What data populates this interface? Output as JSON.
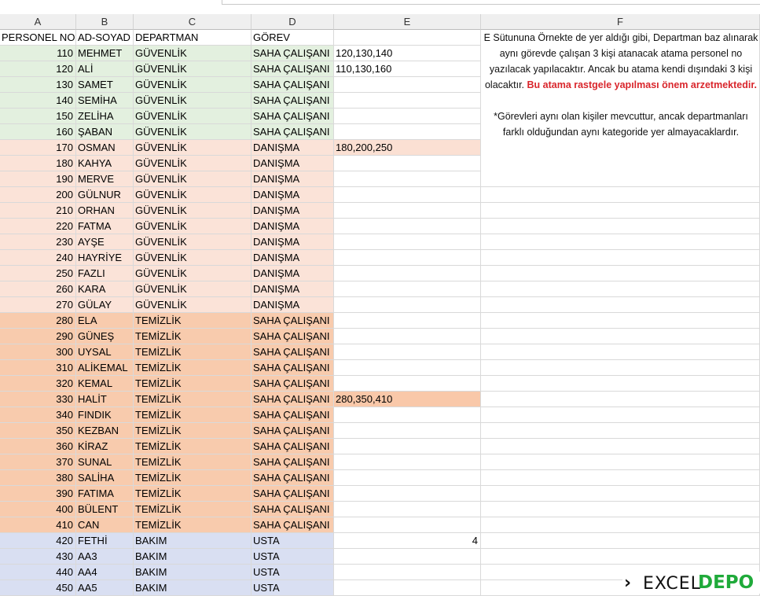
{
  "columns": [
    "A",
    "B",
    "C",
    "D",
    "E",
    "F"
  ],
  "header": [
    "PERSONEL NO",
    "AD-SOYAD",
    "DEPARTMAN",
    "GÖREV",
    "",
    ""
  ],
  "colors": {
    "green": "#e3f0df",
    "peach": "#fbe3d8",
    "orange": "#f8cbad",
    "blue": "#d9dff2",
    "e_highlight_peach": "#fbe0d3",
    "e_highlight_orange": "#f9c8a9",
    "note_red": "#d9262c",
    "logo_green": "#1faa3a"
  },
  "rows": [
    {
      "no": "110",
      "name": "MEHMET",
      "dept": "GÜVENLİK",
      "task": "SAHA ÇALIŞANI",
      "e": "120,130,140",
      "group": "green"
    },
    {
      "no": "120",
      "name": "ALİ",
      "dept": "GÜVENLİK",
      "task": "SAHA ÇALIŞANI",
      "e": "110,130,160",
      "group": "green"
    },
    {
      "no": "130",
      "name": "SAMET",
      "dept": "GÜVENLİK",
      "task": "SAHA ÇALIŞANI",
      "e": "",
      "group": "green"
    },
    {
      "no": "140",
      "name": "SEMİHA",
      "dept": "GÜVENLİK",
      "task": "SAHA ÇALIŞANI",
      "e": "",
      "group": "green"
    },
    {
      "no": "150",
      "name": "ZELİHA",
      "dept": "GÜVENLİK",
      "task": "SAHA ÇALIŞANI",
      "e": "",
      "group": "green"
    },
    {
      "no": "160",
      "name": "ŞABAN",
      "dept": "GÜVENLİK",
      "task": "SAHA ÇALIŞANI",
      "e": "",
      "group": "green"
    },
    {
      "no": "170",
      "name": "OSMAN",
      "dept": "GÜVENLİK",
      "task": "DANIŞMA",
      "e": "180,200,250",
      "group": "peach",
      "ehl": "e_highlight_peach"
    },
    {
      "no": "180",
      "name": "KAHYA",
      "dept": "GÜVENLİK",
      "task": "DANIŞMA",
      "e": "",
      "group": "peach"
    },
    {
      "no": "190",
      "name": "MERVE",
      "dept": "GÜVENLİK",
      "task": "DANIŞMA",
      "e": "",
      "group": "peach"
    },
    {
      "no": "200",
      "name": "GÜLNUR",
      "dept": "GÜVENLİK",
      "task": "DANIŞMA",
      "e": "",
      "group": "peach"
    },
    {
      "no": "210",
      "name": "ORHAN",
      "dept": "GÜVENLİK",
      "task": "DANIŞMA",
      "e": "",
      "group": "peach"
    },
    {
      "no": "220",
      "name": "FATMA",
      "dept": "GÜVENLİK",
      "task": "DANIŞMA",
      "e": "",
      "group": "peach"
    },
    {
      "no": "230",
      "name": "AYŞE",
      "dept": "GÜVENLİK",
      "task": "DANIŞMA",
      "e": "",
      "group": "peach"
    },
    {
      "no": "240",
      "name": "HAYRİYE",
      "dept": "GÜVENLİK",
      "task": "DANIŞMA",
      "e": "",
      "group": "peach"
    },
    {
      "no": "250",
      "name": "FAZLI",
      "dept": "GÜVENLİK",
      "task": "DANIŞMA",
      "e": "",
      "group": "peach"
    },
    {
      "no": "260",
      "name": "KARA",
      "dept": "GÜVENLİK",
      "task": "DANIŞMA",
      "e": "",
      "group": "peach"
    },
    {
      "no": "270",
      "name": "GÜLAY",
      "dept": "GÜVENLİK",
      "task": "DANIŞMA",
      "e": "",
      "group": "peach"
    },
    {
      "no": "280",
      "name": "ELA",
      "dept": "TEMİZLİK",
      "task": "SAHA ÇALIŞANI",
      "e": "",
      "group": "orange"
    },
    {
      "no": "290",
      "name": "GÜNEŞ",
      "dept": "TEMİZLİK",
      "task": "SAHA ÇALIŞANI",
      "e": "",
      "group": "orange"
    },
    {
      "no": "300",
      "name": "UYSAL",
      "dept": "TEMİZLİK",
      "task": "SAHA ÇALIŞANI",
      "e": "",
      "group": "orange"
    },
    {
      "no": "310",
      "name": "ALİKEMAL",
      "dept": "TEMİZLİK",
      "task": "SAHA ÇALIŞANI",
      "e": "",
      "group": "orange"
    },
    {
      "no": "320",
      "name": "KEMAL",
      "dept": "TEMİZLİK",
      "task": "SAHA ÇALIŞANI",
      "e": "",
      "group": "orange"
    },
    {
      "no": "330",
      "name": "HALİT",
      "dept": "TEMİZLİK",
      "task": "SAHA ÇALIŞANI",
      "e": "280,350,410",
      "group": "orange",
      "ehl": "e_highlight_orange"
    },
    {
      "no": "340",
      "name": "FINDIK",
      "dept": "TEMİZLİK",
      "task": "SAHA ÇALIŞANI",
      "e": "",
      "group": "orange"
    },
    {
      "no": "350",
      "name": "KEZBAN",
      "dept": "TEMİZLİK",
      "task": "SAHA ÇALIŞANI",
      "e": "",
      "group": "orange"
    },
    {
      "no": "360",
      "name": "KİRAZ",
      "dept": "TEMİZLİK",
      "task": "SAHA ÇALIŞANI",
      "e": "",
      "group": "orange"
    },
    {
      "no": "370",
      "name": "SUNAL",
      "dept": "TEMİZLİK",
      "task": "SAHA ÇALIŞANI",
      "e": "",
      "group": "orange"
    },
    {
      "no": "380",
      "name": "SALİHA",
      "dept": "TEMİZLİK",
      "task": "SAHA ÇALIŞANI",
      "e": "",
      "group": "orange"
    },
    {
      "no": "390",
      "name": "FATIMA",
      "dept": "TEMİZLİK",
      "task": "SAHA ÇALIŞANI",
      "e": "",
      "group": "orange"
    },
    {
      "no": "400",
      "name": "BÜLENT",
      "dept": "TEMİZLİK",
      "task": "SAHA ÇALIŞANI",
      "e": "",
      "group": "orange"
    },
    {
      "no": "410",
      "name": "CAN",
      "dept": "TEMİZLİK",
      "task": "SAHA ÇALIŞANI",
      "e": "",
      "group": "orange"
    },
    {
      "no": "420",
      "name": "FETHİ",
      "dept": "BAKIM",
      "task": "USTA",
      "e": "4",
      "enum": true,
      "group": "blue"
    },
    {
      "no": "430",
      "name": "AA3",
      "dept": "BAKIM",
      "task": "USTA",
      "e": "",
      "group": "blue"
    },
    {
      "no": "440",
      "name": "AA4",
      "dept": "BAKIM",
      "task": "USTA",
      "e": "",
      "group": "blue"
    },
    {
      "no": "450",
      "name": "AA5",
      "dept": "BAKIM",
      "task": "USTA",
      "e": "",
      "group": "blue"
    }
  ],
  "note": {
    "p1": "E Sütununa Örnekte de yer aldığı gibi, Departman baz alınarak aynı görevde çalışan 3 kişi atanacak atama personel no yazılacak yapılacaktır. Ancak bu atama kendi dışındaki 3 kişi olacaktır.",
    "p1_red": "Bu atama rastgele yapılması önem arzetmektedir.",
    "p2": "*Görevleri aynı olan kişiler mevcuttur, ancak departmanları farklı olduğundan aynı kategoride yer almayacaklardır."
  },
  "logo": {
    "text1": "EXCEL",
    "text2": "DEPO"
  }
}
